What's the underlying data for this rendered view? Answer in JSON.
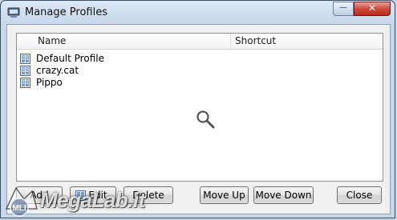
{
  "window": {
    "title": "Manage Profiles",
    "minimize_glyph": "—",
    "close_glyph": "✕"
  },
  "list": {
    "columns": [
      "Name",
      "Shortcut"
    ],
    "rows": [
      {
        "name": "Default Profile",
        "shortcut": ""
      },
      {
        "name": "crazy.cat",
        "shortcut": ""
      },
      {
        "name": "Pippo",
        "shortcut": ""
      }
    ],
    "row_icon": "profile-icon"
  },
  "buttons": {
    "add": "Add",
    "edit": "Edit",
    "delete": "Delete",
    "move_up": "Move Up",
    "move_down": "Move Down",
    "close": "Close"
  },
  "watermark": {
    "text": "MegaLab.it",
    "logo_text": "MLI"
  }
}
